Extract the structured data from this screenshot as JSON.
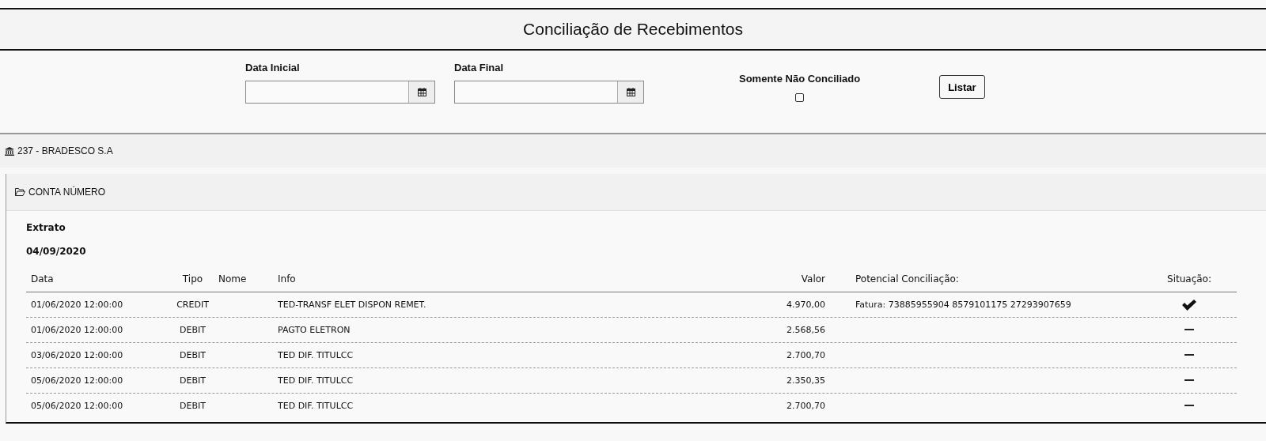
{
  "title": "Conciliação de Recebimentos",
  "filters": {
    "start_date": {
      "label": "Data Inicial"
    },
    "end_date": {
      "label": "Data Final"
    },
    "only_unreconciled": {
      "label": "Somente Não Conciliado",
      "checked": false
    },
    "list_button": "Listar"
  },
  "bank": {
    "name": "237 - BRADESCO S.A"
  },
  "account": {
    "title": "CONTA NÚMERO",
    "section": "Extrato",
    "date": "04/09/2020"
  },
  "table": {
    "columns": [
      "Data",
      "Tipo",
      "Nome",
      "Info",
      "Valor",
      "Potencial Conciliação:",
      "Situação:"
    ],
    "rows": [
      {
        "data": "01/06/2020 12:00:00",
        "tipo": "CREDIT",
        "info": "TED-TRANSF ELET DISPON REMET.",
        "valor": "4.970,00",
        "potencial": "Fatura: 73885955904 8579101175 27293907659",
        "reconciled": true
      },
      {
        "data": "01/06/2020 12:00:00",
        "tipo": "DEBIT",
        "info": "PAGTO ELETRON",
        "valor": "2.568,56",
        "reconciled": false
      },
      {
        "data": "03/06/2020 12:00:00",
        "tipo": "DEBIT",
        "info": "TED DIF. TITULCC",
        "valor": "2.700,70",
        "reconciled": false
      },
      {
        "data": "05/06/2020 12:00:00",
        "tipo": "DEBIT",
        "info": "TED DIF. TITULCC",
        "valor": "2.350,35",
        "reconciled": false
      },
      {
        "data": "05/06/2020 12:00:00",
        "tipo": "DEBIT",
        "info": "TED DIF. TITULCC",
        "valor": "2.700,70",
        "reconciled": false
      }
    ]
  }
}
